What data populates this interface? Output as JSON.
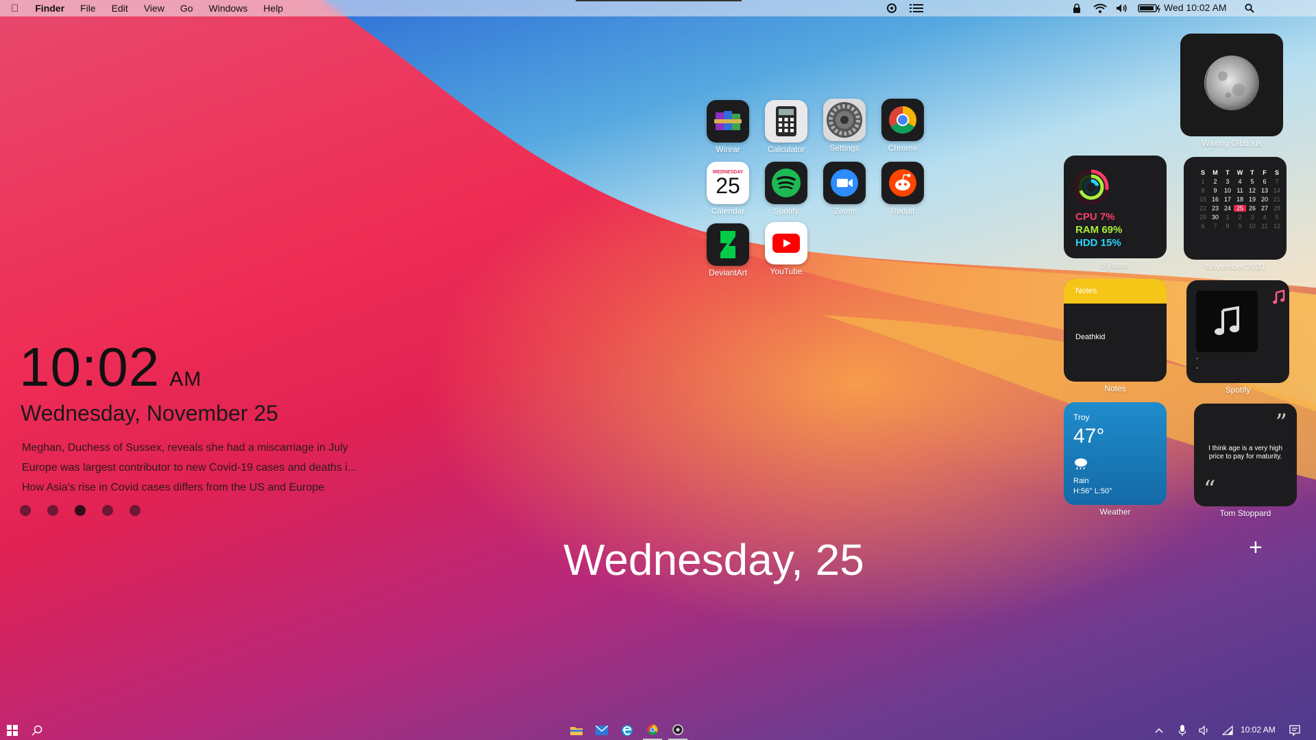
{
  "menubar": {
    "app_name": "Finder",
    "menus": [
      "File",
      "Edit",
      "View",
      "Go",
      "Windows",
      "Help"
    ],
    "datetime": "Wed 10:02 AM"
  },
  "apps": [
    {
      "label": "Winrar",
      "icon": "winrar-icon"
    },
    {
      "label": "Calculator",
      "icon": "calculator-icon"
    },
    {
      "label": "Settings",
      "icon": "settings-gear-icon"
    },
    {
      "label": "Chrome",
      "icon": "chrome-icon"
    },
    {
      "label": "Calendar",
      "icon": "calendar-icon",
      "day_name": "WEDNESDAY",
      "day": "25"
    },
    {
      "label": "Spotify",
      "icon": "spotify-icon"
    },
    {
      "label": "Zoom",
      "icon": "zoom-icon"
    },
    {
      "label": "Reddit",
      "icon": "reddit-icon"
    },
    {
      "label": "DeviantArt",
      "icon": "deviantart-icon"
    },
    {
      "label": "YouTube",
      "icon": "youtube-icon"
    }
  ],
  "clock": {
    "time": "10:02",
    "ampm": "AM",
    "date": "Wednesday, November 25"
  },
  "news": [
    "Meghan, Duchess of Sussex, reveals she had a miscarriage in July",
    "Europe was largest contributor to new Covid-19 cases and deaths i...",
    "How Asia's rise in Covid cases differs from the US and Europe"
  ],
  "big_date": "Wednesday, 25",
  "widgets": {
    "moon": {
      "label": "Waxing Gibbous"
    },
    "system": {
      "label": "System",
      "cpu": "CPU 7%",
      "ram": "RAM 69%",
      "hdd": "HDD 15%"
    },
    "calendar": {
      "label": "November 2020",
      "headers": [
        "S",
        "M",
        "T",
        "W",
        "T",
        "F",
        "S"
      ],
      "rows": [
        [
          "1",
          "2",
          "3",
          "4",
          "5",
          "6",
          "7"
        ],
        [
          "8",
          "9",
          "10",
          "11",
          "12",
          "13",
          "14"
        ],
        [
          "15",
          "16",
          "17",
          "18",
          "19",
          "20",
          "21"
        ],
        [
          "22",
          "23",
          "24",
          "25",
          "26",
          "27",
          "28"
        ],
        [
          "29",
          "30",
          "1",
          "2",
          "3",
          "4",
          "5"
        ],
        [
          "6",
          "7",
          "8",
          "9",
          "10",
          "11",
          "12"
        ]
      ],
      "today": "25"
    },
    "notes": {
      "label": "Notes",
      "header": "Notes",
      "body": "Deathkid"
    },
    "spotify": {
      "label": "Spotify",
      "line1": "-",
      "line2": "-"
    },
    "weather": {
      "label": "Weather",
      "city": "Troy",
      "temp": "47°",
      "condition": "Rain",
      "hilo": "H:56° L:50°"
    },
    "quote": {
      "label": "Tom Stoppard",
      "text": "I think age is a very high price to pay for maturity."
    }
  },
  "taskbar": {
    "time": "10:02 AM"
  },
  "colors": {
    "cpu": "#ff3b6b",
    "ram": "#a8f03a",
    "hdd": "#2ad4ff",
    "notes_header": "#f5c518",
    "weather_bg": "#1a7ab8"
  }
}
